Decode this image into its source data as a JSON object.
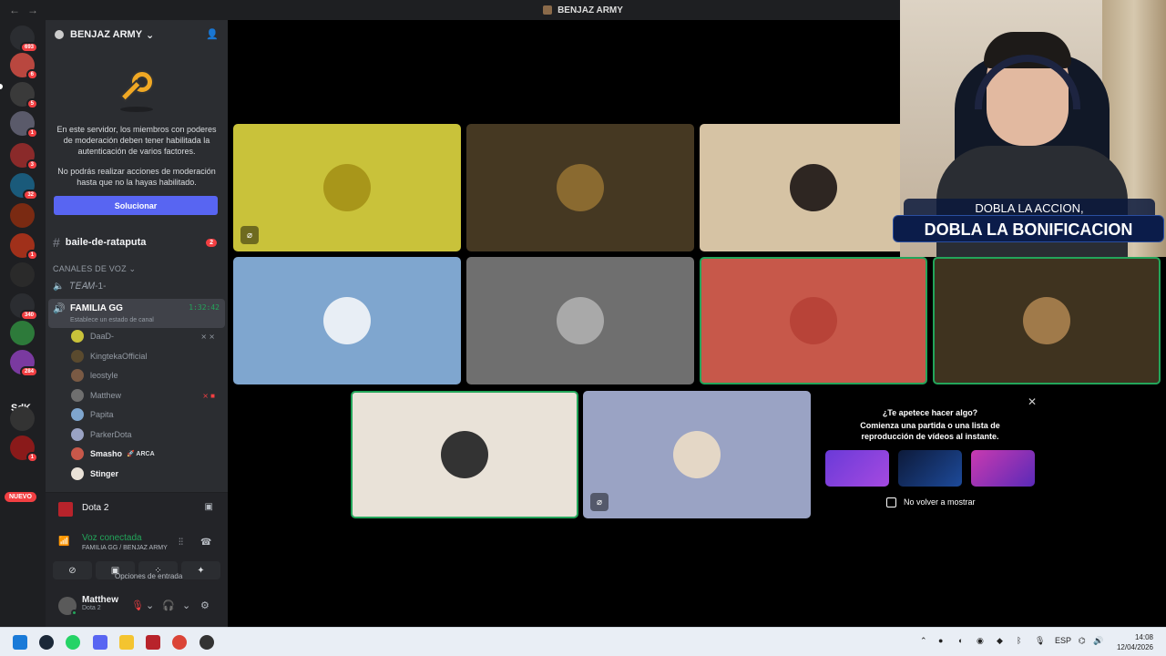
{
  "window": {
    "title": "BENJAZ ARMY"
  },
  "rail": {
    "badges": [
      "693",
      "6",
      "5",
      "1",
      "3",
      "32",
      "1",
      "340",
      "284",
      "1",
      "1"
    ],
    "sdk_label": "SdK",
    "new_label": "NUEVO"
  },
  "server": {
    "name": "BENJAZ ARMY"
  },
  "mfa": {
    "text1": "En este servidor, los miembros con poderes de moderación deben tener habilitada la autenticación de varios factores.",
    "text2": "No podrás realizar acciones de moderación hasta que no la hayas habilitado.",
    "button": "Solucionar"
  },
  "channels": {
    "text_channel": "baile-de-rataputa",
    "text_channel_badge": "2",
    "voice_category": "CANALES DE VOZ",
    "team_channel": "𝑇𝐸𝐴𝑀-1-",
    "active_voice": {
      "name": "FAMILIA GG",
      "time": "1:32:42",
      "status": "Establece un estado de canal"
    }
  },
  "members": [
    {
      "name": "DaaD-",
      "color": "#c9c23a"
    },
    {
      "name": "KingtekaOfficial",
      "color": "#5a4a2e"
    },
    {
      "name": "leostyle",
      "color": "#7a5a44"
    },
    {
      "name": "Matthew",
      "color": "#6f6f6f"
    },
    {
      "name": "Papita",
      "color": "#7fa6cf"
    },
    {
      "name": "ParkerDota",
      "color": "#9aa3c4"
    },
    {
      "name": "Smasho",
      "color": "#c7584a",
      "tag": "ARCA"
    },
    {
      "name": "Stinger",
      "color": "#e9e2d8"
    }
  ],
  "activity": {
    "game": "Dota 2"
  },
  "voice_status": {
    "label": "Voz conectada",
    "location": "FAMILIA GG / BENJAZ ARMY",
    "tooltip": "Opciones de entrada"
  },
  "user": {
    "name": "Matthew",
    "status": "Dota 2"
  },
  "stage": {
    "tiles": [
      {
        "bg": "#c9c23a",
        "av": "#b8a82a"
      },
      {
        "bg": "#453822",
        "av": "#8a6a30"
      },
      {
        "bg": "#d6c3a4",
        "av": "#2e2622"
      },
      {
        "bg": "#7fa6cf",
        "av": "#e8eef5"
      },
      {
        "bg": "#6f6f6f",
        "av": "#aaa"
      },
      {
        "bg": "#c7584a",
        "av": "#b84338"
      },
      {
        "bg": "#3f331f",
        "av": "#a07a4a"
      },
      {
        "bg": "#e9e2d8",
        "av": "#333"
      },
      {
        "bg": "#9aa3c4",
        "av": "#e4d7c6"
      }
    ],
    "prompt": {
      "question": "¿Te apetece hacer algo?",
      "desc": "Comienza una partida o una lista de reproducción de vídeos al instante.",
      "checkbox": "No volver a mostrar"
    }
  },
  "webcam": {
    "banner_top": "DOBLA LA ACCION,",
    "banner_bottom": "DOBLA LA BONIFICACION"
  },
  "taskbar": {
    "lang": "ESP",
    "time": "14:08",
    "date": "12/04/2026"
  }
}
